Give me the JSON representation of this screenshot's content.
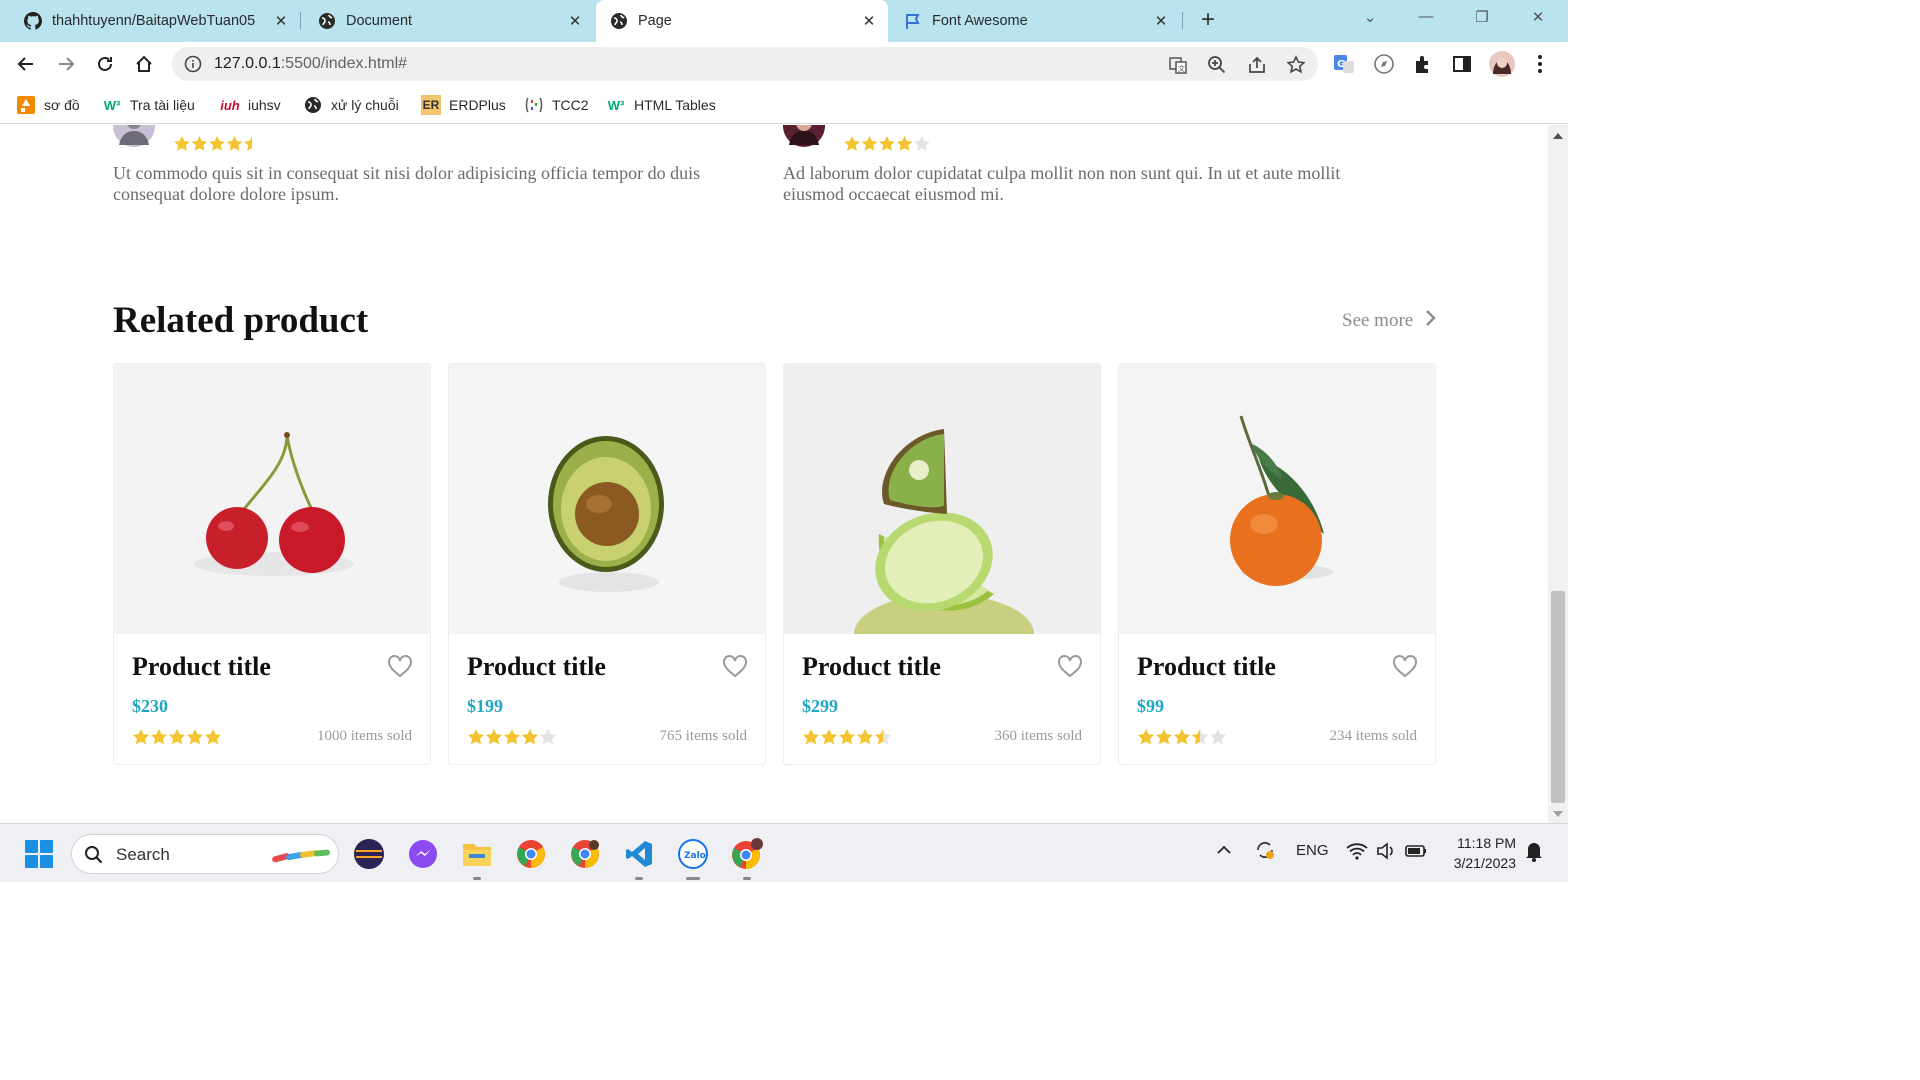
{
  "browser": {
    "tabs": [
      {
        "title": "thahhtuyenn/BaitapWebTuan05",
        "icon": "github-icon"
      },
      {
        "title": "Document",
        "icon": "globe-icon"
      },
      {
        "title": "Page",
        "icon": "globe-icon"
      },
      {
        "title": "Font Awesome",
        "icon": "flag-icon"
      }
    ],
    "url_host": "127.0.0.1",
    "url_path": ":5500/index.html#",
    "bookmarks": [
      {
        "label": "sơ đồ",
        "icon": "orange-shape-icon"
      },
      {
        "label": "Tra tài liệu",
        "icon": "w3-icon"
      },
      {
        "label": "iuhsv",
        "icon": "iuh-icon"
      },
      {
        "label": "xử lý chuỗi",
        "icon": "globe-icon"
      },
      {
        "label": "ERDPlus",
        "icon": "er-icon"
      },
      {
        "label": "TCC2",
        "icon": "tcc-icon"
      },
      {
        "label": "HTML Tables",
        "icon": "w3-icon"
      }
    ],
    "bookmark_er_text": "ER"
  },
  "reviews": [
    {
      "text": "Ut commodo quis sit in consequat sit nisi dolor adipisicing officia tempor do duis consequat dolore dolore ipsum.",
      "rating": 4.5
    },
    {
      "text": "Ad laborum dolor cupidatat culpa mollit non non sunt qui. In ut et aute mollit eiusmod occaecat eiusmod mi.",
      "rating": 4
    }
  ],
  "related": {
    "title": "Related product",
    "see_more": "See more",
    "products": [
      {
        "title": "Product title",
        "price": "$230",
        "rating": 5,
        "sold": "1000 items sold",
        "image": "cherries"
      },
      {
        "title": "Product title",
        "price": "$199",
        "rating": 4,
        "sold": "765 items sold",
        "image": "avocado"
      },
      {
        "title": "Product title",
        "price": "$299",
        "rating": 4.5,
        "sold": "360 items sold",
        "image": "kiwi-lime"
      },
      {
        "title": "Product title",
        "price": "$99",
        "rating": 3.5,
        "sold": "234 items sold",
        "image": "tangerine"
      }
    ]
  },
  "taskbar": {
    "search_placeholder": "Search",
    "language": "ENG",
    "time": "11:18 PM",
    "date": "3/21/2023"
  },
  "colors": {
    "accent_price": "#1ea7c4",
    "star": "#f4c430",
    "tabbar": "#b9e3ef"
  }
}
